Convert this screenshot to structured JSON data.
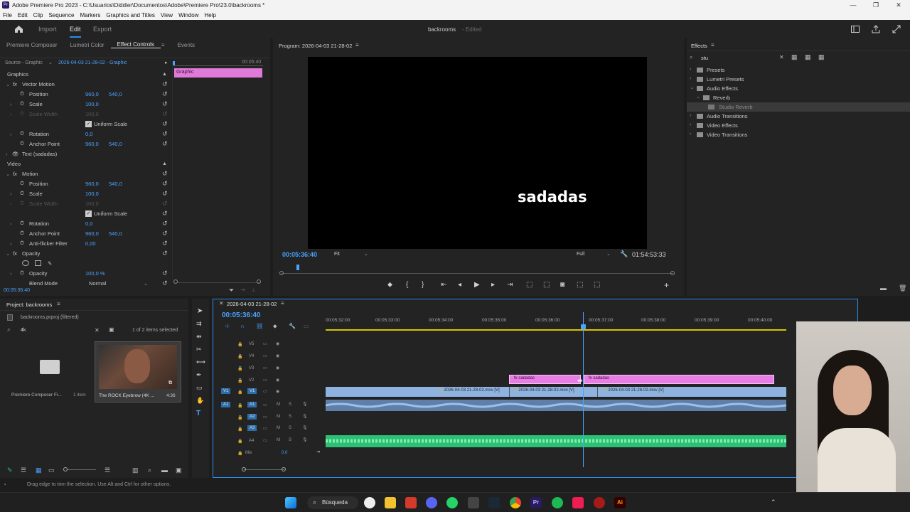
{
  "window": {
    "title": "Adobe Premiere Pro 2023 - C:\\Usuarios\\Diddier\\Documentos\\Adobe\\Premiere Pro\\23.0\\backrooms *",
    "controls": [
      "—",
      "❐",
      "✕"
    ]
  },
  "menu": [
    "File",
    "Edit",
    "Clip",
    "Sequence",
    "Markers",
    "Graphics and Titles",
    "View",
    "Window",
    "Help"
  ],
  "workspace": {
    "tabs": [
      "Import",
      "Edit",
      "Export"
    ],
    "active": "Edit",
    "project_name": "backrooms",
    "project_status": "- Edited"
  },
  "effect_panel": {
    "tabs": [
      "Premiere Composer",
      "Lumetri Color",
      "Effect Controls",
      "Events"
    ],
    "active_tab": "Effect Controls",
    "source": "Source - Graphic",
    "sequence_clip": "2026-04-03 21-28-02 - Graphic",
    "timecode_ruler": "00:05:40",
    "clip_label": "Graphic",
    "sections": {
      "graphics": "Graphics",
      "vector_motion": "Vector Motion",
      "text_layer": "Text (sadadas)",
      "video": "Video",
      "motion": "Motion",
      "opacity": "Opacity"
    },
    "props": {
      "position": "Position",
      "scale": "Scale",
      "scale_width": "Scale Width",
      "uniform_scale": "Uniform Scale",
      "rotation": "Rotation",
      "anchor_point": "Anchor Point",
      "anti_flicker": "Anti-flicker Filter",
      "opacity": "Opacity",
      "blend_mode": "Blend Mode"
    },
    "values": {
      "pos_x": "960,0",
      "pos_y": "540,0",
      "scale": "100,0",
      "scale_width": "100,0",
      "rotation": "0,0",
      "anchor_x": "960,0",
      "anchor_y": "540,0",
      "anti_flicker": "0,00",
      "opacity": "100,0 %",
      "blend_mode": "Normal"
    },
    "bottom_timecode": "00:05:36:40"
  },
  "program": {
    "title": "Program: 2026-04-03 21-28-02",
    "overlay_text": "sadadas",
    "timecode": "00:05:36:40",
    "fit": "Fit",
    "quality": "Full",
    "duration": "01:54:53:33"
  },
  "effects": {
    "title": "Effects",
    "search_value": "stu",
    "tree": [
      {
        "label": "Presets",
        "level": 0
      },
      {
        "label": "Lumetri Presets",
        "level": 0
      },
      {
        "label": "Audio Effects",
        "level": 0
      },
      {
        "label": "Reverb",
        "level": 1
      },
      {
        "label": "Studio Reverb",
        "level": 2
      },
      {
        "label": "Audio Transitions",
        "level": 0
      },
      {
        "label": "Video Effects",
        "level": 0
      },
      {
        "label": "Video Transitions",
        "level": 0
      }
    ]
  },
  "project": {
    "title": "Project: backrooms",
    "file": "backrooms.prproj (filtered)",
    "search_value": "4k",
    "selection_info": "1 of 2 items selected",
    "items": [
      {
        "name": "Premiere Composer Fi...",
        "meta": "1 item"
      },
      {
        "name": "The ROCK Eyebrow (4K ...",
        "meta": "4:36"
      }
    ]
  },
  "timeline": {
    "sequence": "2026-04-03 21-28-02",
    "timecode": "00:05:36:40",
    "ruler": [
      "00:05:32:00",
      "00:05:33:00",
      "00:05:34:00",
      "00:05:35:00",
      "00:05:36:00",
      "00:05:37:00",
      "00:05:38:00",
      "00:05:39:00",
      "00:05:40:00"
    ],
    "video_tracks": [
      "V5",
      "V4",
      "V3",
      "V2",
      "V1"
    ],
    "audio_tracks": [
      "A1",
      "A2",
      "A3",
      "A4"
    ],
    "mix_label": "Mix",
    "mix_value": "0,0",
    "clips": {
      "text1": "sadadas",
      "text2": "sadadas",
      "video1": "2026-04-03 21-28-02.mov [V]",
      "video2": "2026-04-03 21-28-02.mov [V]",
      "video3": "2026-04-03 21-28-02.mov [V]"
    }
  },
  "status_bar": "Drag edge to trim the selection. Use Alt and Ctrl for other options.",
  "taskbar": {
    "search": "Búsqueda"
  },
  "colors": {
    "accent": "#2d8ceb",
    "clip_pink": "#e87de6",
    "clip_blue": "#8fb3e0",
    "clip_green": "#2dbf73",
    "playhead": "#4aa3ff"
  }
}
